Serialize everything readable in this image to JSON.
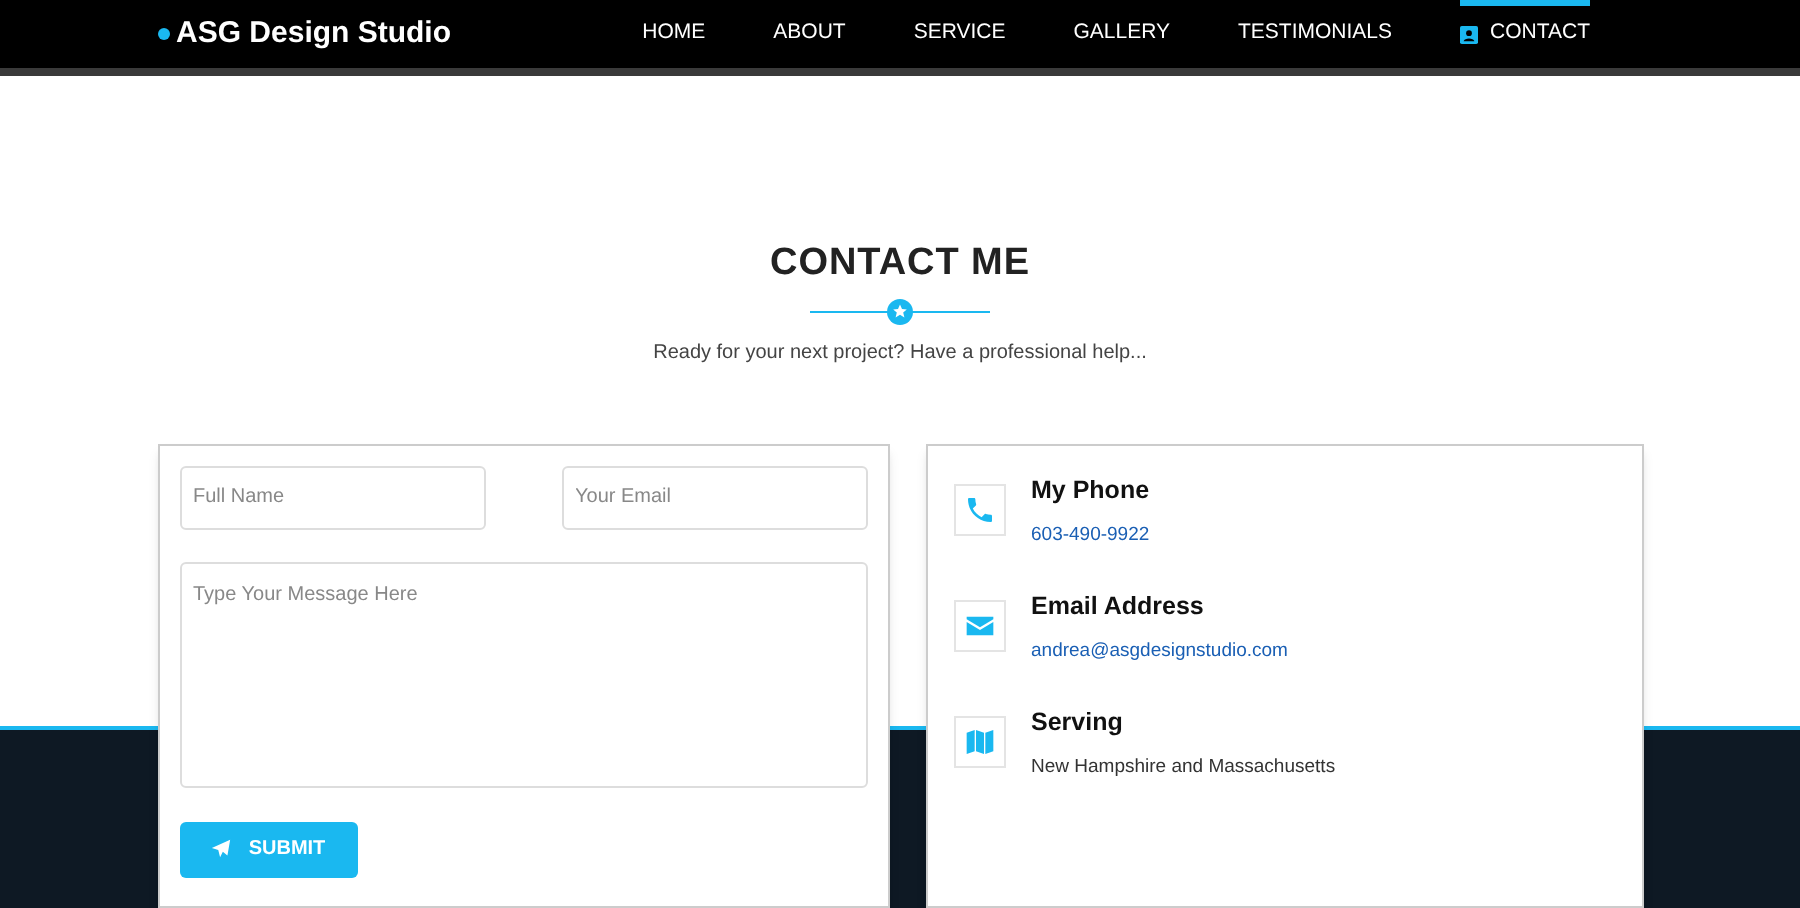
{
  "brand": {
    "name": "ASG Design Studio"
  },
  "nav": [
    {
      "label": "HOME",
      "selected": false
    },
    {
      "label": "ABOUT",
      "selected": false
    },
    {
      "label": "SERVICE",
      "selected": false
    },
    {
      "label": "GALLERY",
      "selected": false
    },
    {
      "label": "TESTIMONIALS",
      "selected": false
    },
    {
      "label": "CONTACT",
      "selected": true
    }
  ],
  "heading": {
    "title": "CONTACT ME",
    "subtitle": "Ready for your next project? Have a professional help..."
  },
  "form": {
    "name": {
      "placeholder": "Full Name"
    },
    "email": {
      "placeholder": "Your Email"
    },
    "message": {
      "placeholder": "Type Your Message Here"
    },
    "submit": "SUBMIT"
  },
  "contact_items": [
    {
      "kind": "phone",
      "title": "My Phone",
      "value": "603-490-9922",
      "link": true
    },
    {
      "kind": "email",
      "title": "Email Address",
      "value": "andrea@asgdesignstudio.com",
      "link": true
    },
    {
      "kind": "map",
      "title": "Serving",
      "value": "New Hampshire and Massachusetts",
      "link": false
    }
  ]
}
